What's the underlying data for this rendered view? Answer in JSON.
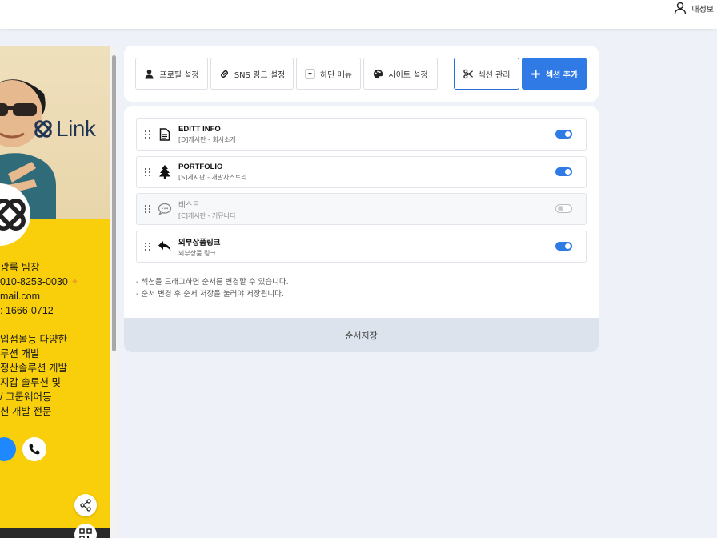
{
  "header": {
    "user_label": "내정보",
    "user_icon": "user-icon"
  },
  "preview": {
    "brand_text": "Link",
    "info_lines": [
      "광록 팀장",
      "010-8253-0030",
      "mail.com",
      "1666-0712"
    ],
    "desc_lines": [
      "입점몰등 다양한",
      "루션 개발",
      "정산솔루션 개발",
      "지갑 솔루션 및",
      "/ 그룹웨어등",
      "션 개발 전문"
    ]
  },
  "toolbar": {
    "profile_label": "프로필 설정",
    "sns_label": "SNS 링크 설정",
    "bottom_menu_label": "하단 메뉴",
    "site_label": "사이트 설정",
    "section_manage_label": "섹션 관리",
    "section_add_label": "섹션 추가"
  },
  "sections": [
    {
      "title": "EDITT INFO",
      "subtitle": "[D]게시판 - 회사소개",
      "icon": "document-icon",
      "enabled": true
    },
    {
      "title": "PORTFOLIO",
      "subtitle": "[S]게시판 - 개발자스토리",
      "icon": "tree-icon",
      "enabled": true
    },
    {
      "title": "테스트",
      "subtitle": "[C]게시판 - 커뮤니티",
      "icon": "chat-icon",
      "enabled": false
    },
    {
      "title": "외부상품링크",
      "subtitle": "외부상품 링크",
      "icon": "reply-icon",
      "enabled": true
    }
  ],
  "notes": [
    "- 섹션을 드래그하면 순서를 변경할 수 있습니다.",
    "- 순서 변경 후 순서 저장을 눌러야 저장됩니다."
  ],
  "save_label": "순서저장",
  "colors": {
    "primary": "#2f7ae5",
    "preview_bg": "#f8cf0a",
    "page_bg": "#eef1f7"
  }
}
